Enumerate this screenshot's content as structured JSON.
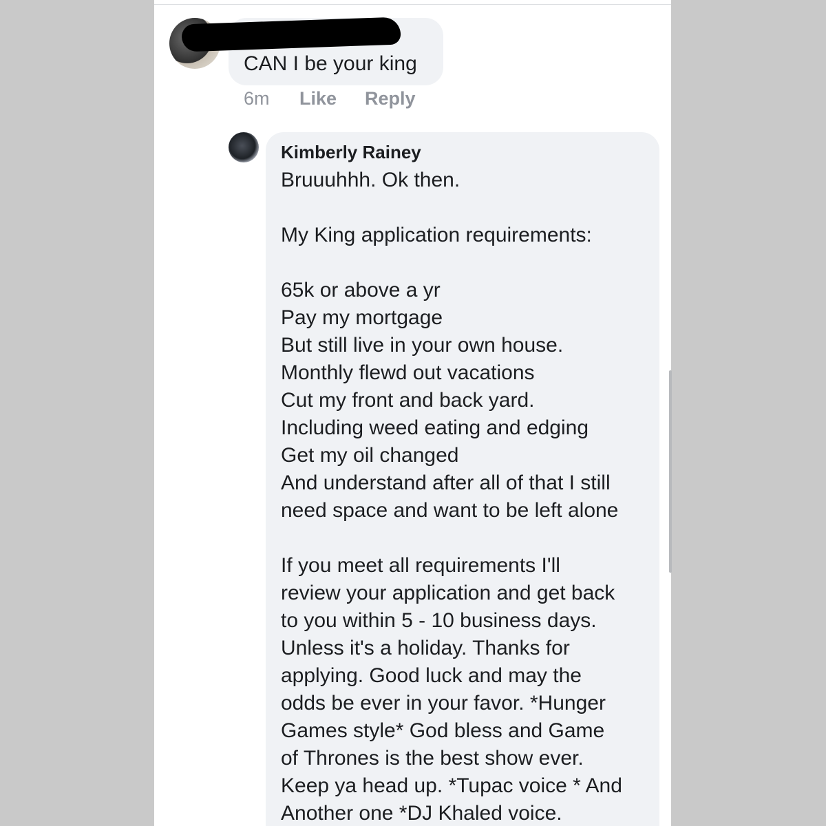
{
  "comment": {
    "avatar_icon": "user-avatar-icon",
    "text": "CAN I be your king",
    "time": "6m",
    "like_label": "Like",
    "reply_label": "Reply"
  },
  "reply": {
    "avatar_icon": "user-avatar-icon",
    "author": "Kimberly Rainey",
    "lines": [
      "Bruuuhhh. Ok then.",
      "",
      "My King application requirements:",
      "",
      "65k or above a yr",
      "Pay my mortgage",
      "But still live in your own house.",
      "Monthly flewd out vacations",
      "Cut my front and back yard.",
      "Including weed eating and edging",
      "Get my oil changed",
      "And understand after all of that I still",
      "need space and want to be left alone",
      "",
      "If you meet all requirements I'll",
      "review your application and get back",
      "to you within 5 - 10 business days.",
      "Unless it's a holiday. Thanks for",
      "applying. Good luck and may the",
      "odds be ever in your favor. *Hunger",
      "Games style* God bless and Game",
      "of Thrones is the best show ever.",
      "Keep ya head up. *Tupac voice * And",
      "Another one *DJ Khaled voice."
    ]
  },
  "colors": {
    "bubble_bg": "#f0f2f5",
    "text": "#1c1e21",
    "meta": "#90949c",
    "outer_bg": "#c9c9c9"
  }
}
